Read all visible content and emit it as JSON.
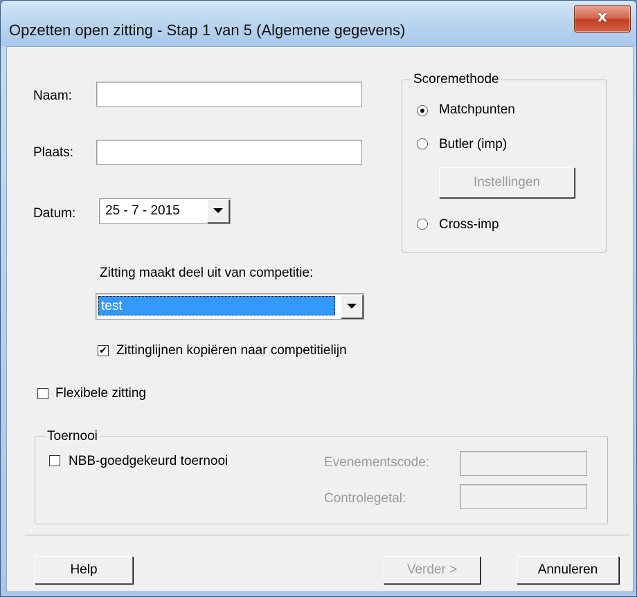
{
  "window": {
    "title": "Opzetten open zitting - Stap 1 van 5 (Algemene gegevens)",
    "close_glyph": "x"
  },
  "form": {
    "naam_label": "Naam:",
    "naam_value": "",
    "plaats_label": "Plaats:",
    "plaats_value": "",
    "datum_label": "Datum:",
    "datum_value": "25 - 7 - 2015",
    "competitie_label": "Zitting maakt deel uit van competitie:",
    "competitie_value": "test",
    "kopieren_label": "Zittinglijnen kopiëren naar competitielijn",
    "kopieren_checked": true,
    "flexibele_label": "Flexibele zitting",
    "flexibele_checked": false
  },
  "scoremethode": {
    "title": "Scoremethode",
    "options": [
      {
        "label": "Matchpunten",
        "selected": true
      },
      {
        "label": "Butler (imp)",
        "selected": false
      },
      {
        "label": "Cross-imp",
        "selected": false
      }
    ],
    "instellingen_label": "Instellingen"
  },
  "toernooi": {
    "title": "Toernooi",
    "nbb_label": "NBB-goedgekeurd toernooi",
    "nbb_checked": false,
    "evenementscode_label": "Evenementscode:",
    "evenementscode_value": "",
    "controlegetal_label": "Controlegetal:",
    "controlegetal_value": ""
  },
  "buttons": {
    "help": "Help",
    "verder": "Verder >",
    "annuleren": "Annuleren"
  },
  "colors": {
    "selection": "#3399ff",
    "disabled_text": "#9a9a9a"
  }
}
